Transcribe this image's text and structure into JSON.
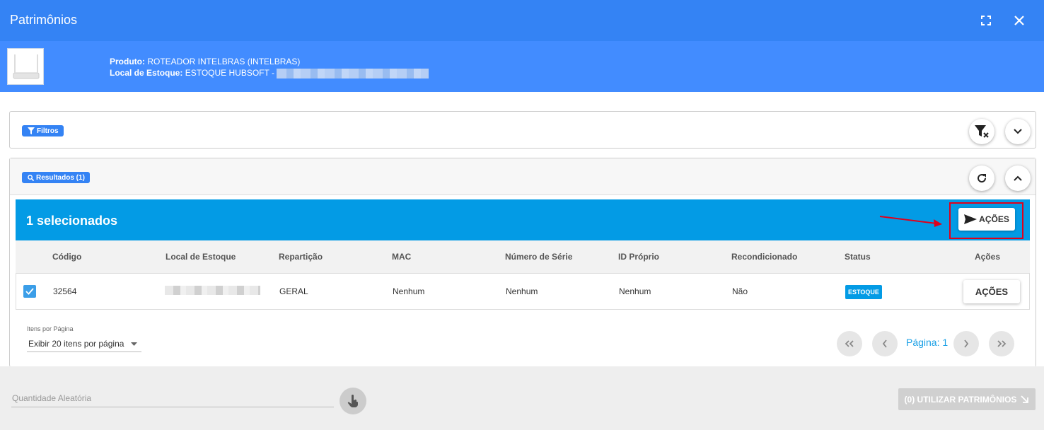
{
  "window": {
    "title": "Patrimônios"
  },
  "product": {
    "produto_label": "Produto:",
    "produto_value": "ROTEADOR INTELBRAS (INTELBRAS)",
    "local_label": "Local de Estoque:",
    "local_value": "ESTOQUE HUBSOFT -"
  },
  "filters": {
    "chip_label": "Filtros"
  },
  "results": {
    "chip_label": "Resultados (1)",
    "selected_text": "1 selecionados",
    "actions_label": "AÇÕES",
    "columns": [
      "Código",
      "Local de Estoque",
      "Repartição",
      "MAC",
      "Número de Série",
      "ID Próprio",
      "Recondicionado",
      "Status",
      "Ações"
    ],
    "rows": [
      {
        "codigo": "32564",
        "reparticao": "GERAL",
        "mac": "Nenhum",
        "serie": "Nenhum",
        "id_proprio": "Nenhum",
        "recondicionado": "Não",
        "status": "ESTOQUE",
        "acoes": "AÇÕES",
        "checked": true
      }
    ]
  },
  "pagination": {
    "per_page_label": "Itens por Página",
    "per_page_value": "Exibir 20 itens por página",
    "page_text": "Página: 1"
  },
  "footer": {
    "qty_placeholder": "Quantidade Aleatória",
    "use_button": "(0) UTILIZAR PATRIMÔNIOS"
  },
  "colors": {
    "header": "#3483f4",
    "info_bar": "#428cff",
    "selection_bar": "#039be5",
    "highlight": "#e0001b"
  }
}
